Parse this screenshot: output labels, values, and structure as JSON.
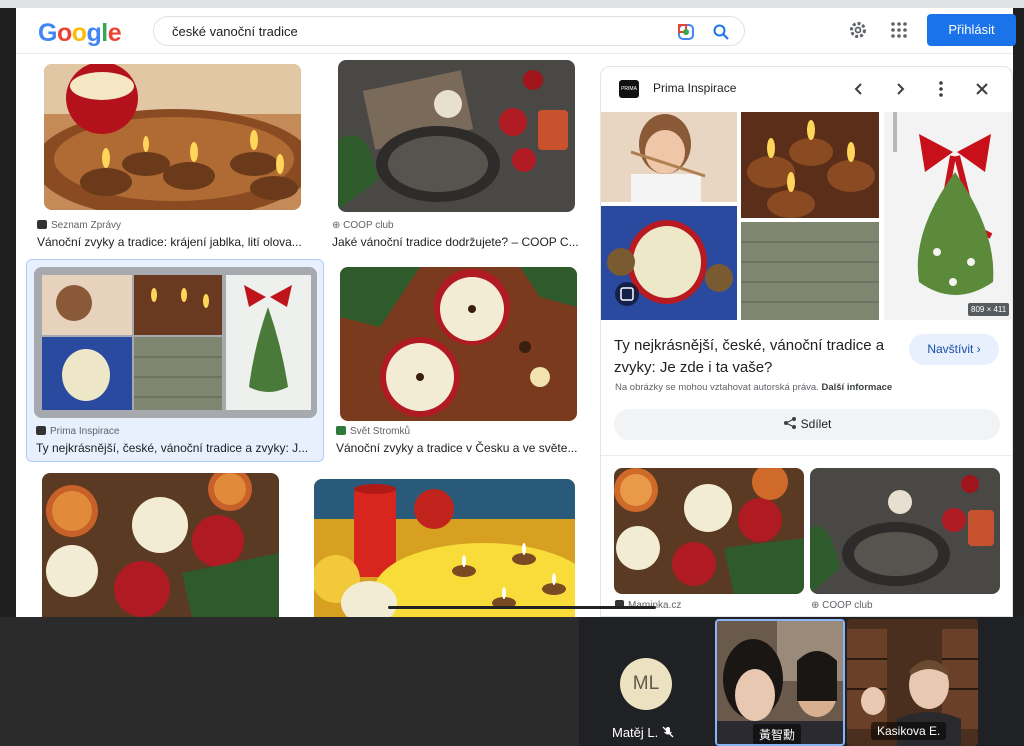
{
  "search": {
    "logo": "Google",
    "query": "české vanoční tradice",
    "signin_label": "Přihlásit"
  },
  "results": [
    {
      "source": "Seznam Zprávy",
      "title": "Vánoční zvyky a tradice: krájení jablka, lití olova..."
    },
    {
      "source": "COOP club",
      "title": "Jaké vánoční tradice dodržujete? – COOP C..."
    },
    {
      "source": "Prima Inspirace",
      "title": "Ty nejkrásnější, české, vánoční tradice a zvyky: J..."
    },
    {
      "source": "Svět Stromků",
      "title": "Vánoční zvyky a tradice v Česku a ve světe..."
    }
  ],
  "panel": {
    "source": "Prima Inspirace",
    "favicon_text": "PRIMA",
    "image_dims": "809 × 411",
    "title": "Ty nejkrásnější, české, vánoční tradice a zvyky: Je zde i ta vaše?",
    "visit_label": "Navštívit",
    "copyright_note": "Na obrázky se mohou vztahovat autorská práva.",
    "more_info": "Další informace",
    "share_label": "Sdílet",
    "related": [
      {
        "source": "Maminka.cz"
      },
      {
        "source": "COOP club"
      }
    ]
  },
  "meeting": {
    "participants": [
      {
        "initials": "ML",
        "name": "Matěj L.",
        "muted": true
      },
      {
        "name": "黃智勳"
      },
      {
        "name": "Kasikova E."
      }
    ]
  },
  "colors": {
    "brand_blue": "#1a73e8",
    "selected_card_bg": "#e8f0fe",
    "meeting_bg": "#202124"
  }
}
